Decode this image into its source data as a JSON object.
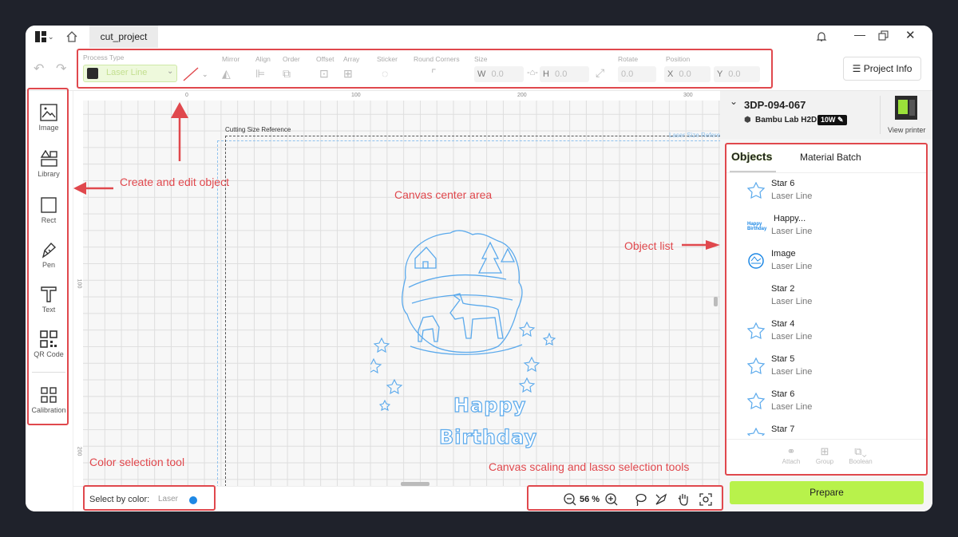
{
  "tab": {
    "title": "cut_project"
  },
  "toolbar": {
    "process_type_label": "Process Type",
    "process_type_value": "Laser Line",
    "mirror_label": "Mirror",
    "align_label": "Align",
    "order_label": "Order",
    "offset_label": "Offset",
    "array_label": "Array",
    "sticker_label": "Sticker",
    "round_corners_label": "Round Corners",
    "size_label": "Size",
    "w_label": "W",
    "w_value": "0.0",
    "h_label": "H",
    "h_value": "0.0",
    "rotate_label": "Rotate",
    "rotate_value": "0.0",
    "position_label": "Position",
    "x_label": "X",
    "x_value": "0.0",
    "y_label": "Y",
    "y_value": "0.0",
    "project_info": "Project Info"
  },
  "sidebar": {
    "items": [
      {
        "label": "Image",
        "icon": "image-icon"
      },
      {
        "label": "Library",
        "icon": "library-icon"
      },
      {
        "label": "Rect",
        "icon": "rect-icon"
      },
      {
        "label": "Pen",
        "icon": "pen-icon"
      },
      {
        "label": "Text",
        "icon": "text-icon"
      },
      {
        "label": "QR Code",
        "icon": "qr-code-icon"
      },
      {
        "label": "Calibration",
        "icon": "calibration-icon"
      }
    ]
  },
  "canvas": {
    "ruler_top": [
      "0",
      "100",
      "200",
      "300"
    ],
    "ruler_left": [
      "100",
      "200"
    ],
    "cutting_ref": "Cutting Size Reference",
    "laser_ref": "Laser Size Refere",
    "design_line1": "Happy",
    "design_line2": "Birthday"
  },
  "bottom": {
    "select_label": "Select by color:",
    "select_value": "Laser",
    "zoom": "56 %",
    "laser_color": "#1e88e5"
  },
  "printer": {
    "name": "3DP-094-067",
    "model": "Bambu Lab H2D",
    "power": "10W",
    "view_printer": "View printer"
  },
  "panel": {
    "tab_objects": "Objects",
    "tab_material": "Material Batch",
    "objects": [
      {
        "name": "Star 6",
        "sub": "Laser Line",
        "icon": "star-icon"
      },
      {
        "name": "Happy...",
        "sub": "Laser Line",
        "icon": "text-thumb-icon"
      },
      {
        "name": "Image",
        "sub": "Laser Line",
        "icon": "image-thumb-icon"
      },
      {
        "name": "Star 2",
        "sub": "Laser Line",
        "icon": ""
      },
      {
        "name": "Star 4",
        "sub": "Laser Line",
        "icon": "star-icon"
      },
      {
        "name": "Star 5",
        "sub": "Laser Line",
        "icon": "star-icon"
      },
      {
        "name": "Star 6",
        "sub": "Laser Line",
        "icon": "star-icon"
      },
      {
        "name": "Star 7",
        "sub": "",
        "icon": "star-icon"
      }
    ],
    "attach": "Attach",
    "group": "Group",
    "boolean": "Boolean",
    "prepare": "Prepare"
  },
  "annotations": {
    "create_edit": "Create and edit object",
    "canvas_center": "Canvas center area",
    "object_list": "Object list",
    "color_tool": "Color selection tool",
    "scaling_tools": "Canvas scaling and lasso selection tools"
  },
  "colors": {
    "accent": "#b8f24b",
    "annotation": "#e0484d",
    "laser_blue": "#5aa9ec"
  }
}
